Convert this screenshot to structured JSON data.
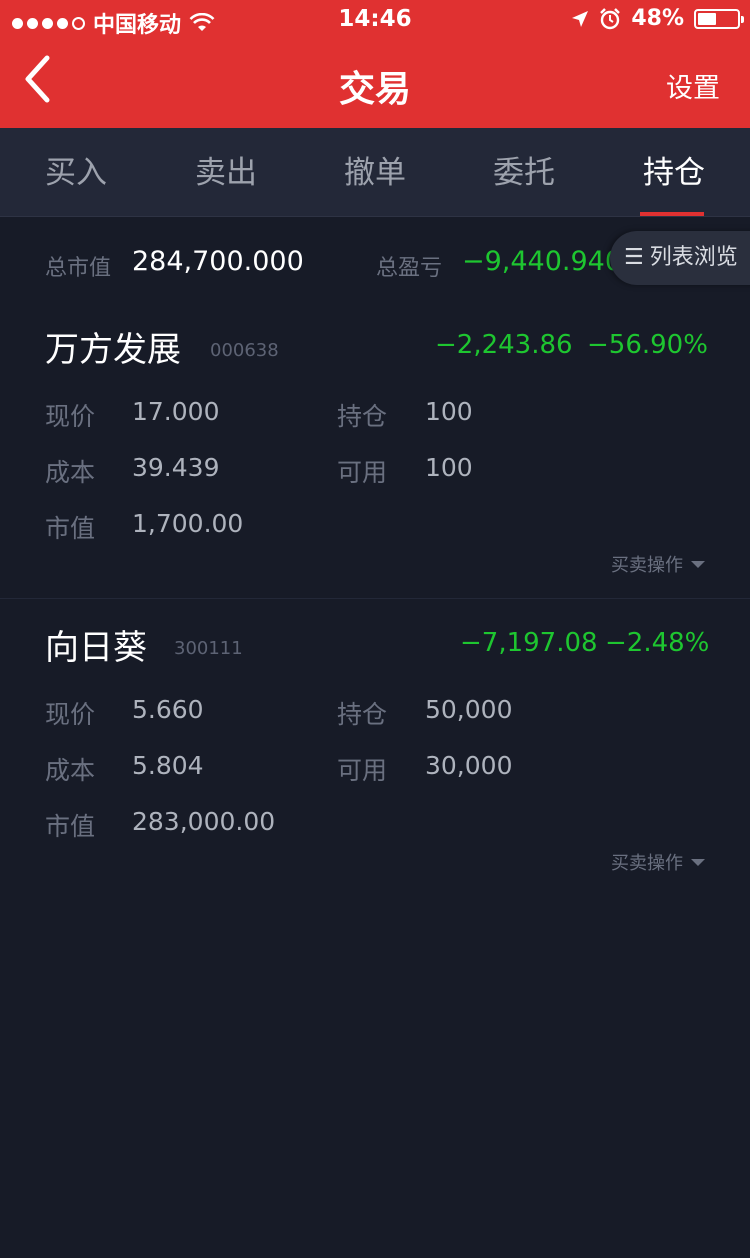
{
  "status_bar": {
    "carrier": "中国移动",
    "time": "14:46",
    "battery": "48%",
    "battery_level": 0.48
  },
  "navbar": {
    "title": "交易",
    "settings": "设置"
  },
  "tabs": [
    {
      "label": "买入"
    },
    {
      "label": "卖出"
    },
    {
      "label": "撤单"
    },
    {
      "label": "委托"
    },
    {
      "label": "持仓",
      "active": true
    }
  ],
  "summary": {
    "market_value_label": "总市值",
    "market_value": "284,700.000",
    "total_pl_label": "总盈亏",
    "total_pl": "−9,440.940",
    "list_view_label": "列表浏览"
  },
  "holdings": [
    {
      "name": "万方发展",
      "code": "000638",
      "pl_amount": "−2,243.86",
      "pl_percent": "−56.90%",
      "price_label": "现价",
      "price": "17.000",
      "position_label": "持仓",
      "position": "100",
      "cost_label": "成本",
      "cost": "39.439",
      "available_label": "可用",
      "available": "100",
      "value_label": "市值",
      "value": "1,700.00",
      "action_label": "买卖操作"
    },
    {
      "name": "向日葵",
      "code": "300111",
      "pl_amount": "−7,197.08",
      "pl_percent": "−2.48%",
      "price_label": "现价",
      "price": "5.660",
      "position_label": "持仓",
      "position": "50,000",
      "cost_label": "成本",
      "cost": "5.804",
      "available_label": "可用",
      "available": "30,000",
      "value_label": "市值",
      "value": "283,000.00",
      "action_label": "买卖操作"
    }
  ],
  "colors": {
    "accent": "#e03131",
    "loss": "#1ec630",
    "background": "#171b27"
  }
}
